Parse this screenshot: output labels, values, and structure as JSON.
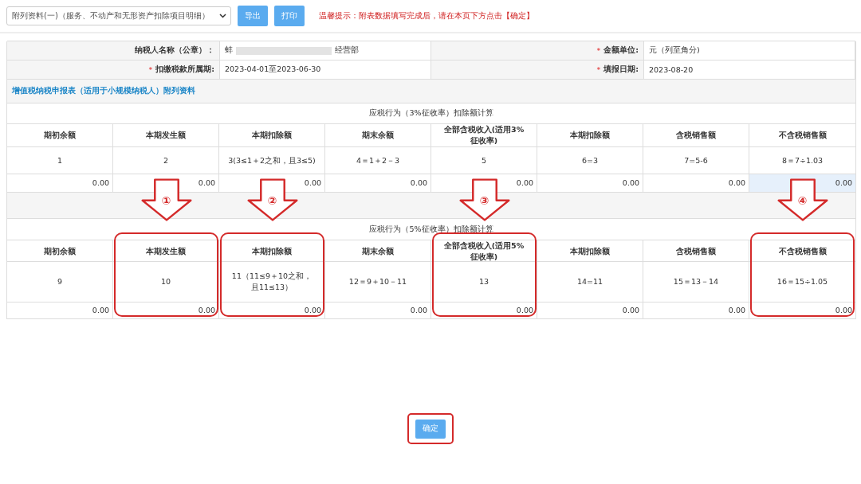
{
  "toolbar": {
    "form_select": "附列资料(一)（服务、不动产和无形资产扣除项目明细）",
    "buttons": [
      "导出",
      "打印"
    ],
    "notice": "温馨提示：附表数据填写完成后，请在本页下方点击【确定】"
  },
  "info": [
    {
      "label": "纳税人名称（公章）：",
      "value_start": "蚌",
      "value_end": "经营部",
      "redacted": true
    },
    {
      "required_mark": "*",
      "label": "金额单位:",
      "value": "元（列至角分)"
    },
    {
      "required_mark": "*",
      "label": "扣缴税款所属期:",
      "value": "2023-04-01至2023-06-30"
    },
    {
      "required_mark": "*",
      "label": "填报日期:",
      "value": "2023-08-20"
    }
  ],
  "report_link": "增值税纳税申报表（适用于小规模纳税人）附列资料",
  "sections": [
    {
      "title": "应税行为（3%征收率）扣除额计算",
      "columns": [
        {
          "header": "期初余额",
          "formula": "1",
          "value": "0.00",
          "focused": false
        },
        {
          "header": "本期发生额",
          "formula": "2",
          "value": "0.00",
          "focused": false
        },
        {
          "header": "本期扣除额",
          "formula": "3(3≤1＋2之和，且3≤5)",
          "value": "0.00",
          "focused": false
        },
        {
          "header": "期末余额",
          "formula": "4＝1＋2－3",
          "value": "0.00",
          "focused": false
        },
        {
          "header": "全部含税收入(适用3%征收率)",
          "formula": "5",
          "value": "0.00",
          "focused": false
        },
        {
          "header": "本期扣除额",
          "formula": "6=3",
          "value": "0.00",
          "focused": false
        },
        {
          "header": "含税销售额",
          "formula": "7=5-6",
          "value": "0.00",
          "focused": false
        },
        {
          "header": "不含税销售额",
          "formula": "8＝7÷1.03",
          "value": "0.00",
          "focused": true
        }
      ]
    },
    {
      "title": "应税行为（5%征收率）扣除额计算",
      "columns": [
        {
          "header": "期初余额",
          "formula": "9",
          "value": "0.00",
          "focused": false
        },
        {
          "header": "本期发生额",
          "formula": "10",
          "value": "0.00",
          "focused": false,
          "annotation": "①"
        },
        {
          "header": "本期扣除额",
          "formula": "11（11≤9＋10之和，且11≤13）",
          "value": "0.00",
          "focused": false,
          "annotation": "②"
        },
        {
          "header": "期末余额",
          "formula": "12＝9＋10－11",
          "value": "0.00",
          "focused": false
        },
        {
          "header": "全部含税收入(适用5%征收率)",
          "formula": "13",
          "value": "0.00",
          "focused": false,
          "annotation": "③"
        },
        {
          "header": "本期扣除额",
          "formula": "14=11",
          "value": "0.00",
          "focused": false
        },
        {
          "header": "含税销售额",
          "formula": "15＝13－14",
          "value": "0.00",
          "focused": false
        },
        {
          "header": "不含税销售额",
          "formula": "16＝15÷1.05",
          "value": "0.00",
          "focused": false,
          "annotation": "④"
        }
      ]
    }
  ],
  "confirm_button": {
    "label": "确定",
    "highlighted": true
  }
}
